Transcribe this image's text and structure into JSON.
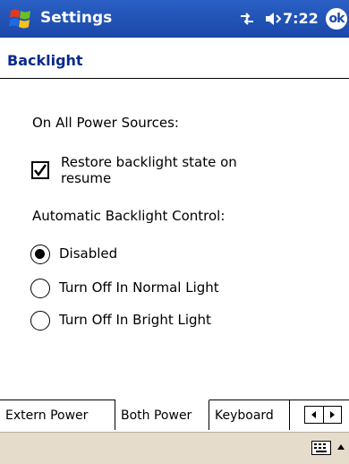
{
  "titlebar": {
    "title": "Settings",
    "time": "7:22",
    "ok_label": "ok",
    "icons": [
      "windows-start-icon",
      "connectivity-icon",
      "volume-icon"
    ],
    "colors": {
      "background": "#1a48a8",
      "text": "#ffffff"
    }
  },
  "page": {
    "title": "Backlight",
    "title_color": "#0a2a8a"
  },
  "power_section": {
    "label": "On All Power Sources:",
    "restore_checkbox": {
      "label": "Restore backlight state on resume",
      "checked": true
    }
  },
  "auto_section": {
    "label": "Automatic Backlight Control:",
    "options": [
      {
        "label": "Disabled",
        "selected": true
      },
      {
        "label": "Turn Off In Normal Light",
        "selected": false
      },
      {
        "label": "Turn Off In Bright Light",
        "selected": false
      }
    ]
  },
  "tabs": [
    {
      "label": "Extern Power",
      "active": false
    },
    {
      "label": "Both Power",
      "active": true
    },
    {
      "label": "Keyboard",
      "active": false
    }
  ],
  "tab_scroll": {
    "icons": [
      "tab-scroll-left-icon",
      "tab-scroll-right-icon"
    ]
  },
  "menubar": {
    "icons": [
      "keyboard-icon",
      "input-arrow-icon"
    ],
    "color": "#e6dccc"
  }
}
